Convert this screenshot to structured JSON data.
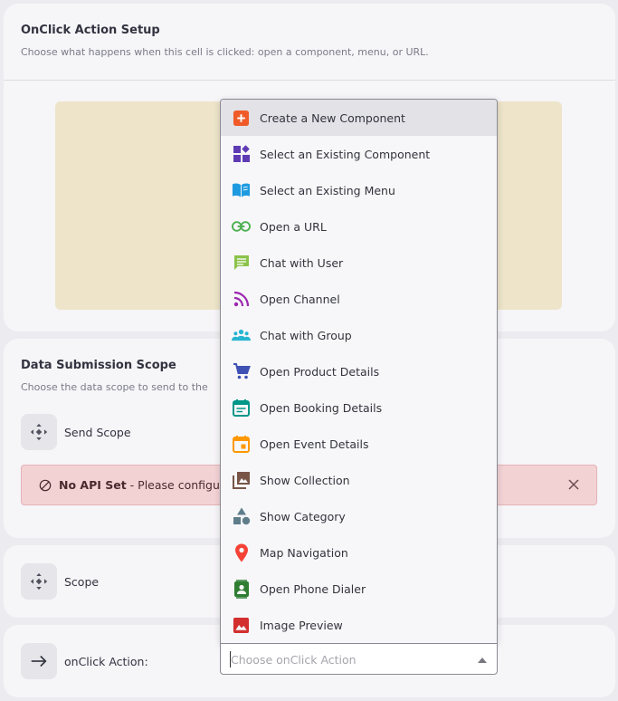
{
  "onclick_setup": {
    "title": "OnClick Action Setup",
    "subtitle": "Choose what happens when this cell is clicked: open a component, menu, or URL."
  },
  "data_submission": {
    "title": "Data Submission Scope",
    "subtitle": "Choose the data scope to send to the",
    "send_scope_label": "Send Scope",
    "alert": {
      "bold": "No API Set",
      "text": " - Please configu"
    }
  },
  "scope": {
    "label": "Scope"
  },
  "onclick_action": {
    "label": "onClick Action:",
    "placeholder": "Choose onClick Action"
  },
  "menu": {
    "items": [
      {
        "label": "Create a New Component",
        "icon": "plus-square-icon",
        "color": "#f05a28"
      },
      {
        "label": "Select an Existing Component",
        "icon": "widgets-icon",
        "color": "#5e3bb3"
      },
      {
        "label": "Select an Existing Menu",
        "icon": "book-open-icon",
        "color": "#1e9be0"
      },
      {
        "label": "Open a URL",
        "icon": "link-icon",
        "color": "#4caf50"
      },
      {
        "label": "Chat with User",
        "icon": "chat-icon",
        "color": "#8bc34a"
      },
      {
        "label": "Open Channel",
        "icon": "rss-icon",
        "color": "#9c27b0"
      },
      {
        "label": "Chat with Group",
        "icon": "group-icon",
        "color": "#26b5d1"
      },
      {
        "label": "Open Product Details",
        "icon": "cart-icon",
        "color": "#3f51b5"
      },
      {
        "label": "Open Booking Details",
        "icon": "calendar-icon",
        "color": "#009688"
      },
      {
        "label": "Open Event Details",
        "icon": "event-icon",
        "color": "#ff9800"
      },
      {
        "label": "Show Collection",
        "icon": "collection-icon",
        "color": "#795548"
      },
      {
        "label": "Show Category",
        "icon": "category-icon",
        "color": "#607d8b"
      },
      {
        "label": "Map Navigation",
        "icon": "map-pin-icon",
        "color": "#f44336"
      },
      {
        "label": "Open Phone Dialer",
        "icon": "phone-contact-icon",
        "color": "#2e7d32"
      },
      {
        "label": "Image Preview",
        "icon": "image-icon",
        "color": "#d32f2f"
      }
    ]
  }
}
